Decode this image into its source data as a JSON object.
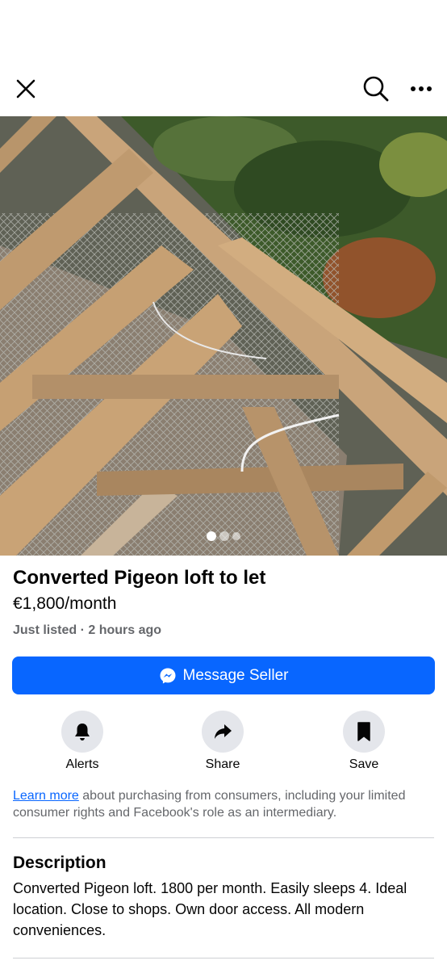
{
  "header": {
    "close_icon": "close-icon",
    "search_icon": "search-icon",
    "more_icon": "more-icon"
  },
  "gallery": {
    "count": 3,
    "active_index": 0
  },
  "listing": {
    "title": "Converted Pigeon loft to let",
    "price": "€1,800/month",
    "meta": "Just listed · 2 hours ago"
  },
  "message_button": {
    "label": "Message Seller",
    "icon": "messenger-icon",
    "color": "#0866ff"
  },
  "actions": [
    {
      "label": "Alerts",
      "icon": "bell-icon"
    },
    {
      "label": "Share",
      "icon": "share-arrow-icon"
    },
    {
      "label": "Save",
      "icon": "bookmark-icon"
    }
  ],
  "consumer_notice": {
    "link": "Learn more",
    "text": " about purchasing from consumers, including your limited consumer rights and Facebook's role as an intermediary."
  },
  "description": {
    "heading": "Description",
    "body": "Converted Pigeon loft. 1800 per month. Easily sleeps 4. Ideal location. Close to shops. Own door access. All modern conveniences."
  }
}
